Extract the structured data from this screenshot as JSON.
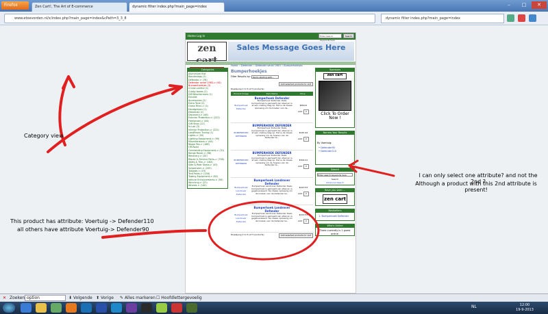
{
  "browser": {
    "menu_button": "Firefox",
    "tabs": [
      "Zen Cart!, The Art of E-commerce",
      "dynamic filter index.php?main_page=index"
    ],
    "url": "www.etoevorden.nl/x/index.php?main_page=index&cPath=3_3_8",
    "search_text": "dynamic filter index.php?main_page=index"
  },
  "store": {
    "nav": "Home   Log In",
    "search_placeholder": "Enter search keywords here",
    "search_button": "Search",
    "logo_text": "zen cart",
    "logo_sub": "the art of e-commerce",
    "banner": "Sales Message Goes Here",
    "breadcrumb": "Home :: Defender :: Defender serial 1983 :: Bumperhoekjes",
    "categories_title": "Categories",
    "categories": [
      {
        "t": "Aluminium Kist",
        "c": "cat"
      },
      {
        "t": "Bandenlegs (3)",
        "c": "cat"
      },
      {
        "t": "Defender-> (78)",
        "c": "cat"
      },
      {
        "t": "  Defender serief 1983-> (61)",
        "c": "red"
      },
      {
        "t": "  Bumperhoekjes (3)",
        "c": "red"
      },
      {
        "t": "  Cruise control (1)",
        "c": "cat"
      },
      {
        "t": "  Cubby boxes (1)",
        "c": "cat"
      },
      {
        "t": "  Diff Beschermers (1)",
        "c": "cat"
      },
      {
        "t": "  Entaille",
        "c": "cat"
      },
      {
        "t": "Accessoires (2)",
        "c": "cat"
      },
      {
        "t": "  Extra Tank (2)",
        "c": "cat"
      },
      {
        "t": "  Grass Filter-> (3)",
        "c": "cat"
      },
      {
        "t": "  Handgrepen (1)",
        "c": "cat"
      },
      {
        "t": "  Dieselcap (1)",
        "c": "cat"
      },
      {
        "t": "Discovery-> (46)",
        "c": "cat"
      },
      {
        "t": "Exterior Protection-> (222)",
        "c": "cat"
      },
      {
        "t": "Freelander-> (44)",
        "c": "cat"
      },
      {
        "t": "Gift Shop (12)",
        "c": "cat"
      },
      {
        "t": "In-Lok (3)",
        "c": "cat"
      },
      {
        "t": "Interior Protection-> (222)",
        "c": "cat"
      },
      {
        "t": "LandRover Tuning (1)",
        "c": "cat"
      },
      {
        "t": "Lights-> (59)",
        "c": "cat"
      },
      {
        "t": "Lighting Equipment-> (99)",
        "c": "cat"
      },
      {
        "t": "Miscellaneous-> (44)",
        "c": "cat"
      },
      {
        "t": "Nippo Tee-> (186)",
        "c": "cat"
      },
      {
        "t": "Off-Road",
        "c": "cat"
      },
      {
        "t": "Overlanding Equipment-> (31)",
        "c": "cat"
      },
      {
        "t": "Range Rover-> (96)",
        "c": "cat"
      },
      {
        "t": "Recovery-> (35)",
        "c": "cat"
      },
      {
        "t": "Repair & Service Parts-> (708)",
        "c": "cat"
      },
      {
        "t": "Seats & Trim-> (164)",
        "c": "cat"
      },
      {
        "t": "Side & Rear Steps-> (43)",
        "c": "cat"
      },
      {
        "t": "Suspension-> (205)",
        "c": "cat"
      },
      {
        "t": "Tailgate-> (19)",
        "c": "cat"
      },
      {
        "t": "Tent Poles-> (156)",
        "c": "cat"
      },
      {
        "t": "Towing Equipment-> (82)",
        "c": "cat"
      },
      {
        "t": "Vehicle Enhancements-> (90)",
        "c": "cat"
      },
      {
        "t": "Winching-> (27)",
        "c": "cat"
      },
      {
        "t": "Wheels-> (140)",
        "c": "cat"
      }
    ],
    "page_title": "Bumperhoekjes",
    "filter_label": "Filter Results by:",
    "filter_value": "Items starting with...",
    "add_selected": "Add selected products to cart",
    "displaying": "Displaying 1 to 5 (of 5 products)",
    "table_head": [
      "Product Image",
      "Item Name",
      "Price"
    ],
    "products": [
      {
        "img": "Bumperhoek Defender",
        "name": "Bumperhoek Defender",
        "desc": "Bumperhoek Defender Deze bumperhoek is gemaakt van staal en is af een coating laag op. Het is de ideale oplossing om de hoeken van de...",
        "price": "€96.02"
      },
      {
        "img": "BUMPERHOEK DEFENDER",
        "name": "BUMPERHOEK DEFENDER",
        "desc": "Bumperhoek Defender Deze bumperhoek is gemaakt van staal en is af een coating laag op. Het is de ideale oplossing om de hoeken van de Defender te...",
        "price": "€187.94"
      },
      {
        "img": "BUMPERHOEK DEFENDER",
        "name": "BUMPERHOEK DEFENDER",
        "desc": "Bumperhoek Defender Deze bumperhoek is gemaakt van staal en is af een coating laag op. Het is de ideale oplossing om de hoeken van de Defender te...",
        "price": "€303.41"
      },
      {
        "img": "Bumperhoek Landrover Defender",
        "name": "Bumperhoek Landrover Defender",
        "desc": "Bumperhoek Landrover Defender Deze bumperhoek is gemaakt van staal en is gegalvaniseerd. De ideale oplossing om de hoeken van de Defender te...",
        "price": "€213.53"
      },
      {
        "img": "Bumperhoek Landrover Defender",
        "name": "Bumperhoek Landrover Defender",
        "desc": "Bumperhoek Landrover Defender Deze bumperhoek is gemaakt van staal en is gegalvaniseerd. De ideale oplossing om de hoeken van de Defender te...",
        "price": "€213.53"
      }
    ],
    "qty_label": "Add:",
    "qty_value": "0",
    "sponsors_title": "Sponsors",
    "click_to_order": "Click To Order Now !",
    "narrow_title": "Narrow Your Results",
    "narrow_by": "By Voertuig:",
    "narrow_items": [
      "Defender90",
      "Defender110"
    ],
    "search_title": "Search",
    "search_hint": "Enter search keywords here",
    "search_btn": "Search",
    "advanced_search": "Advanced Search",
    "have_you_seen": "Have you seen ...",
    "bestsellers_title": "Bestsellers",
    "bestseller_item": "1. Bumperhoek Defender",
    "whos_online_title": "Who's Online",
    "whos_online": "There currently is 1 guest online."
  },
  "annotations": {
    "category": "Category view",
    "attribute_line1": "I can only select one attribute? and not the 2nd ?",
    "attribute_line2": "Although a product with this 2nd attribute is present!",
    "product_line1": "This product has attribute: Voertuig -> Defender110",
    "product_line2": "all others have attribute Voertuig-> Defender90"
  },
  "findbar": {
    "label": "Zoeken:",
    "value": "option",
    "next": "Volgende",
    "prev": "Vorige",
    "highlight": "Alles markeren",
    "match_case": "Hoofdlettergevoelig"
  },
  "taskbar": {
    "time": "12:00",
    "date": "19-9-2013",
    "lang": "NL"
  },
  "colors": {
    "annotation_red": "#e02020",
    "zen_green": "#2f7a2f"
  }
}
